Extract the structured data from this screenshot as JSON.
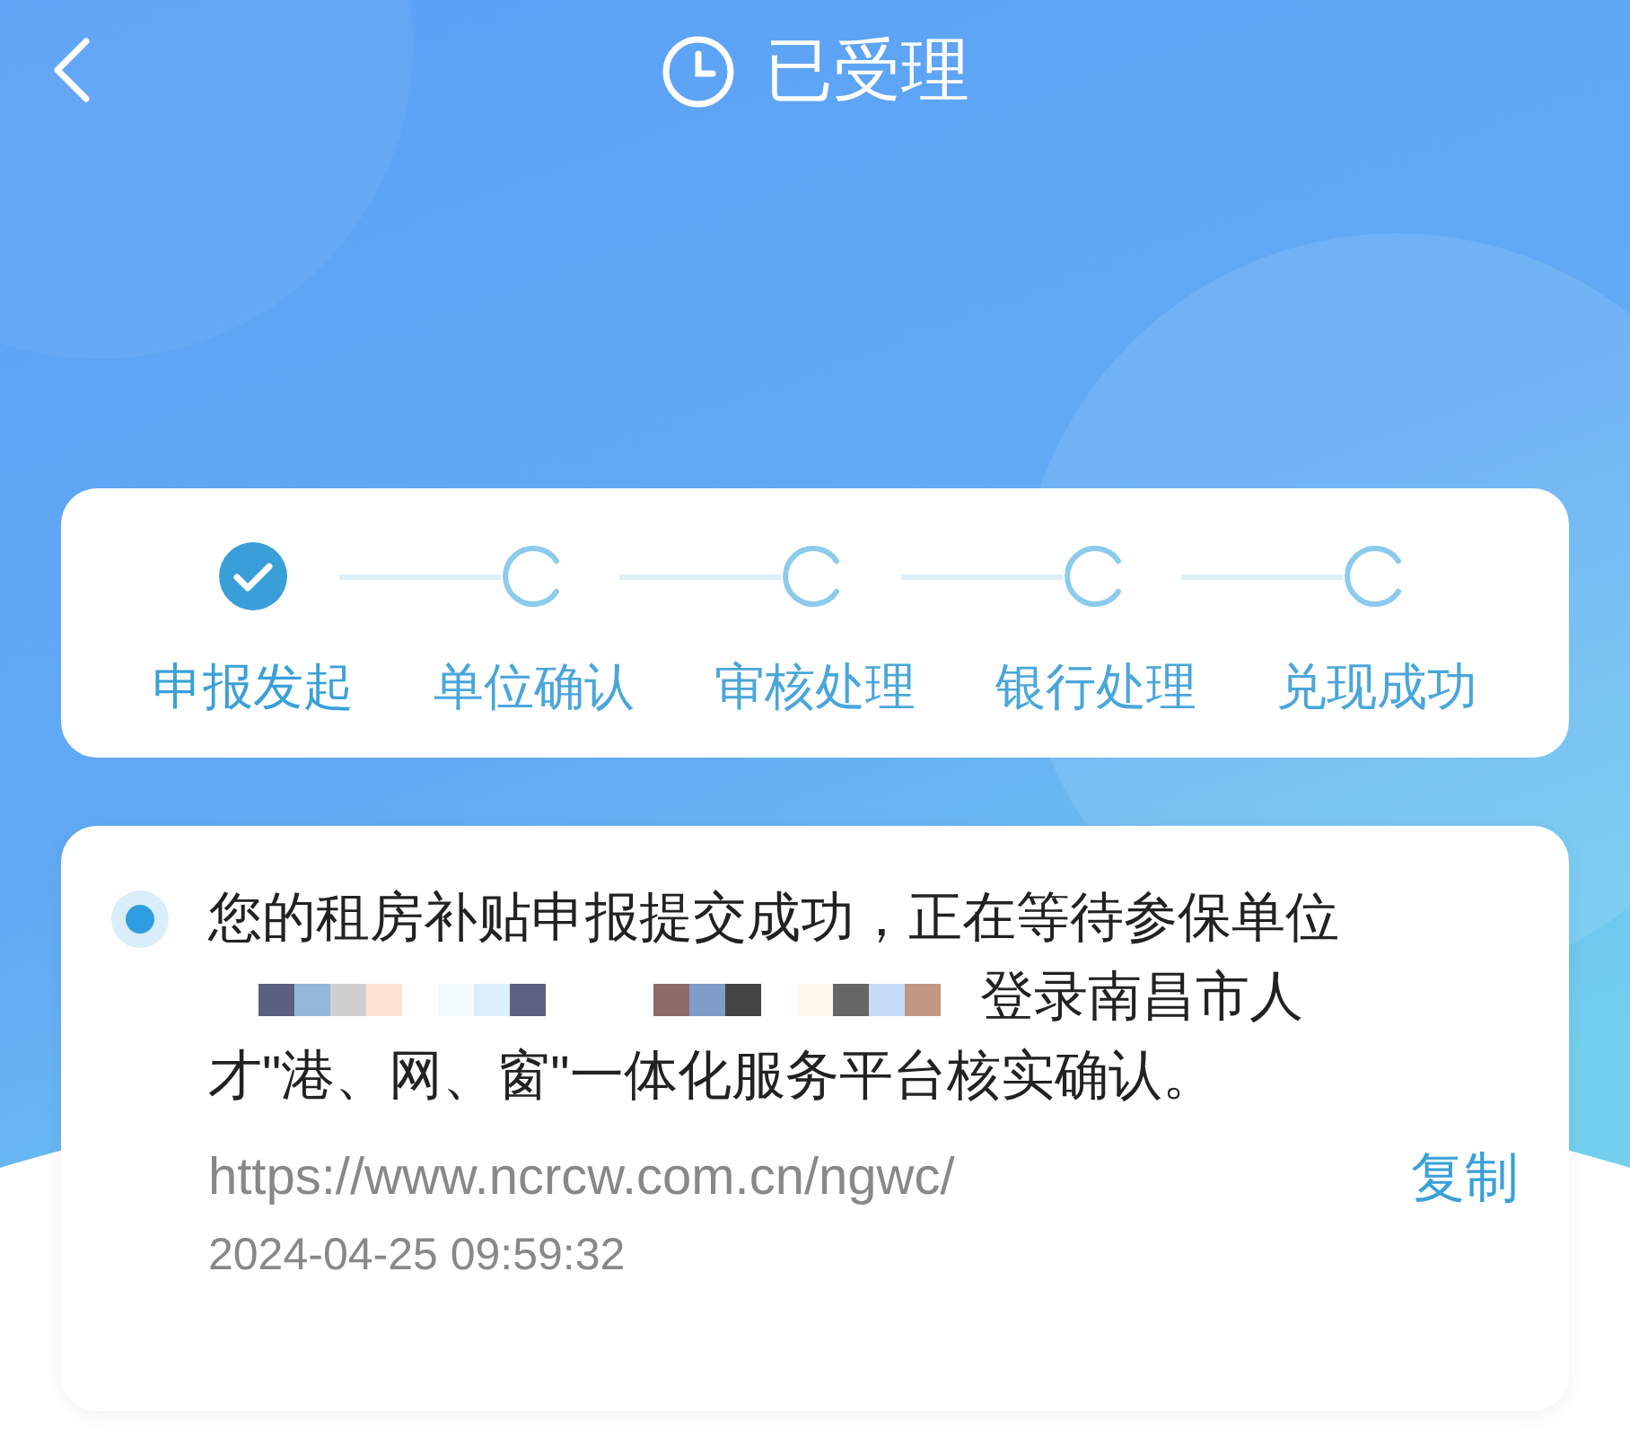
{
  "header": {
    "title": "已受理"
  },
  "steps": [
    {
      "label": "申报发起",
      "done": true
    },
    {
      "label": "单位确认",
      "done": false
    },
    {
      "label": "审核处理",
      "done": false
    },
    {
      "label": "银行处理",
      "done": false
    },
    {
      "label": "兑现成功",
      "done": false
    }
  ],
  "record": {
    "text_before": "您的租房补贴申报提交成功，正在等待参保单位",
    "redacted": true,
    "text_after": "登录南昌市人才\"港、网、窗\"一体化服务平台核实确认。",
    "url": "https://www.ncrcw.com.cn/ngwc/",
    "copy_label": "复制",
    "time": "2024-04-25 09:59:32"
  }
}
